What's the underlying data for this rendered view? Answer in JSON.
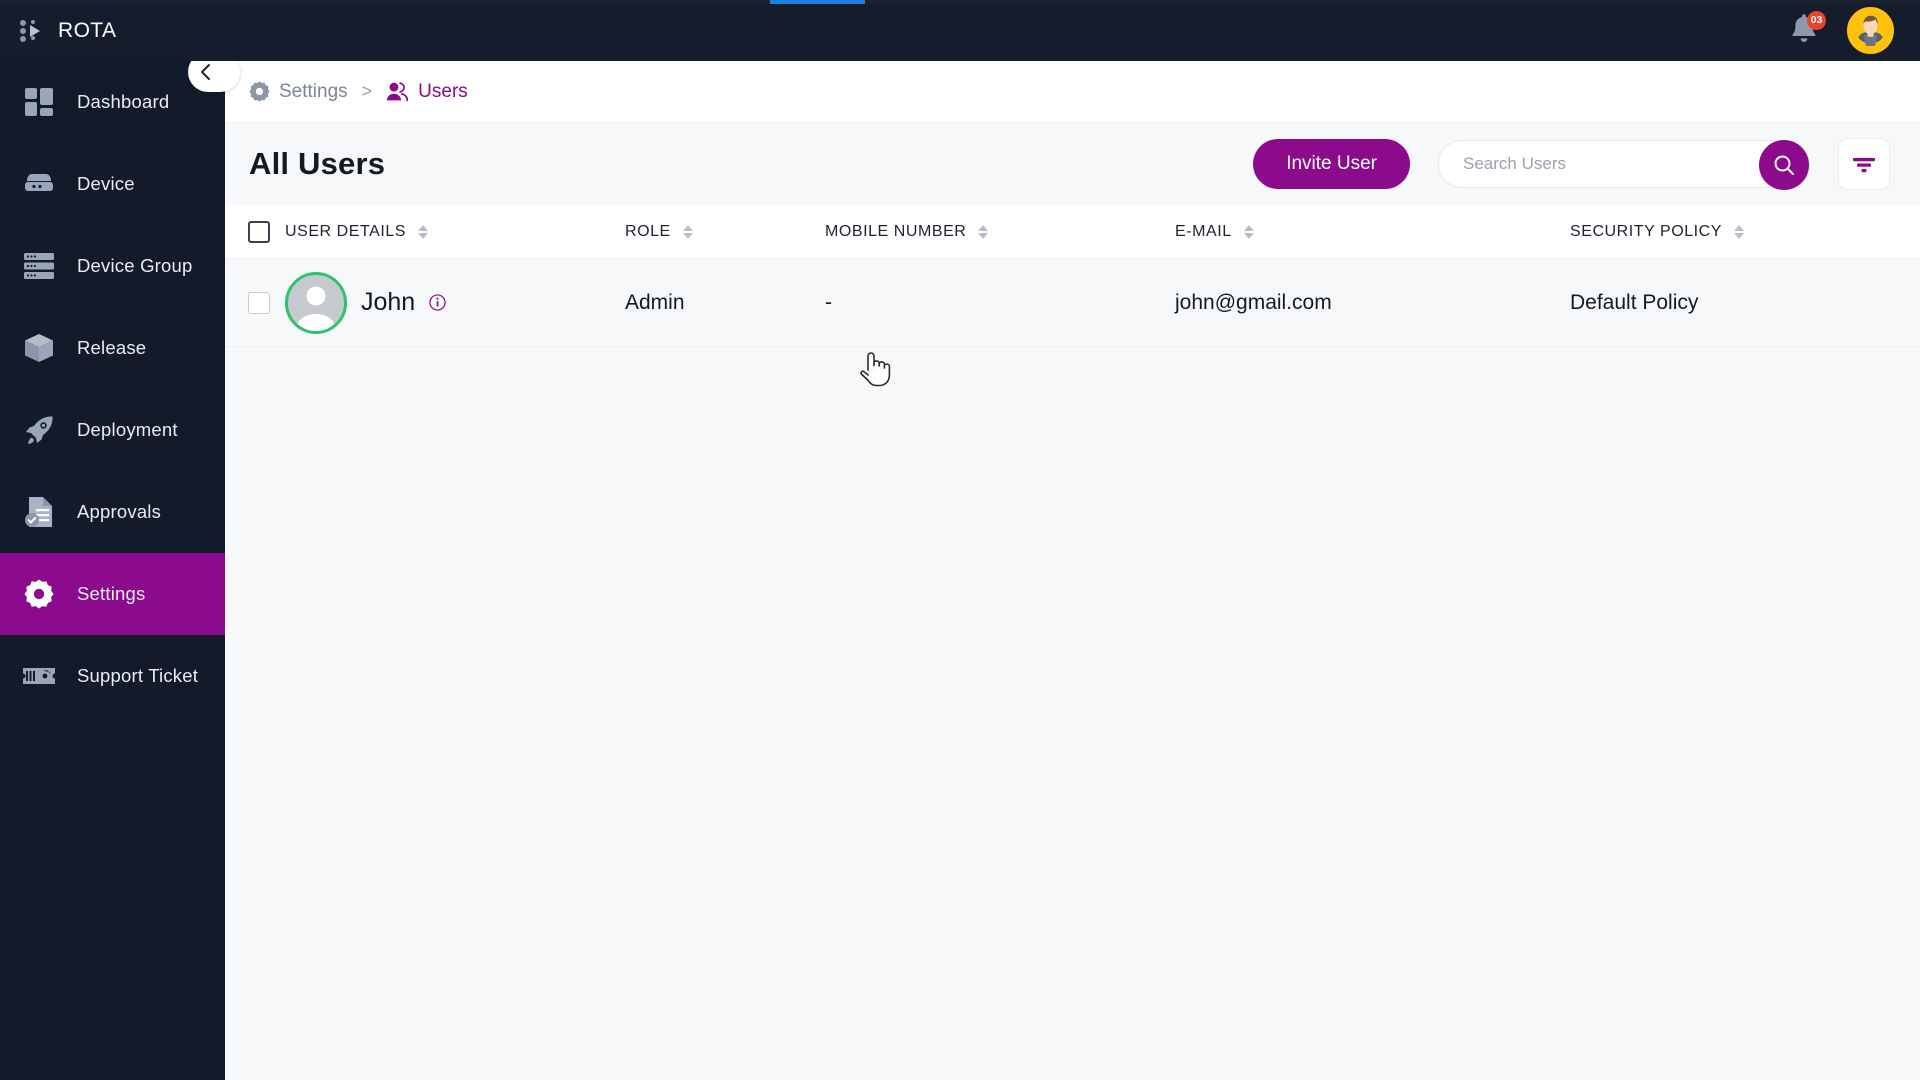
{
  "app": {
    "brand_title": "ROTA",
    "brand_icon": "rota-logo-icon"
  },
  "topbar": {
    "notification_icon": "bell-icon",
    "notification_count": "03",
    "avatar_icon": "user-avatar-icon"
  },
  "progress": {
    "label": "page-loading-bar",
    "color": "#1d7fe0"
  },
  "sidebar": {
    "collapse_icon": "chevron-left-icon",
    "items": [
      {
        "label": "Dashboard",
        "icon": "dashboard-icon",
        "active": false
      },
      {
        "label": "Device",
        "icon": "device-icon",
        "active": false
      },
      {
        "label": "Device Group",
        "icon": "device-group-icon",
        "active": false
      },
      {
        "label": "Release",
        "icon": "release-box-icon",
        "active": false
      },
      {
        "label": "Deployment",
        "icon": "rocket-icon",
        "active": false
      },
      {
        "label": "Approvals",
        "icon": "approvals-icon",
        "active": false
      },
      {
        "label": "Settings",
        "icon": "gear-icon",
        "active": true
      },
      {
        "label": "Support Ticket",
        "icon": "support-ticket-icon",
        "active": false
      }
    ]
  },
  "breadcrumb": {
    "separator": ">",
    "items": [
      {
        "label": "Settings",
        "icon": "gear-icon"
      },
      {
        "label": "Users",
        "icon": "users-icon"
      }
    ]
  },
  "header": {
    "title": "All Users",
    "invite_label": "Invite User",
    "search_placeholder": "Search Users",
    "search_value": "",
    "search_icon": "search-icon",
    "filter_icon": "filter-icon"
  },
  "table": {
    "columns": [
      {
        "label": "USER DETAILS",
        "sortable": true
      },
      {
        "label": "ROLE",
        "sortable": true
      },
      {
        "label": "MOBILE NUMBER",
        "sortable": true
      },
      {
        "label": "E-MAIL",
        "sortable": true
      },
      {
        "label": "SECURITY POLICY",
        "sortable": true
      }
    ],
    "rows": [
      {
        "selected": false,
        "name": "John",
        "status_ring": "#2fc26e",
        "info_icon": "info-icon",
        "role": "Admin",
        "mobile": "-",
        "email": "john@gmail.com",
        "policy": "Default Policy"
      }
    ]
  },
  "colors": {
    "accent": "#8c0b8c",
    "sidebar_bg": "#131b2a",
    "topbar_bg": "#151c2b",
    "online": "#2fc26e",
    "badge": "#e8452c"
  },
  "cursor": {
    "icon": "pointer-hand-cursor"
  }
}
